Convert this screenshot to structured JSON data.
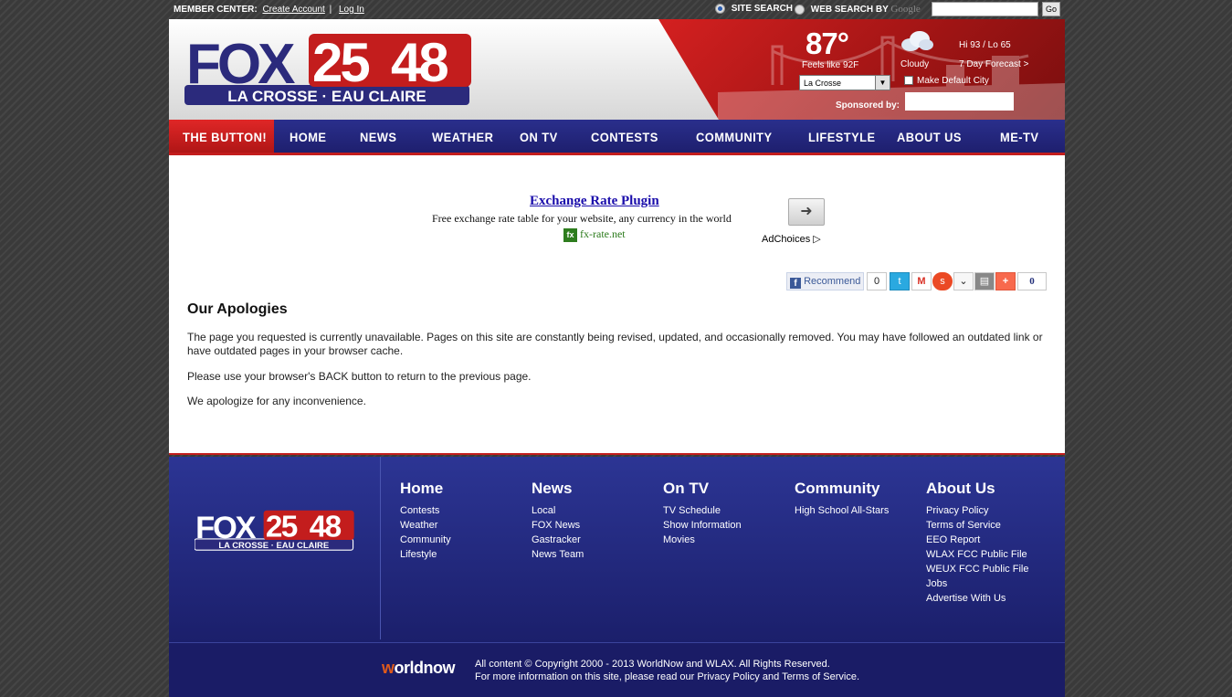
{
  "topbar": {
    "member_center": "MEMBER CENTER:",
    "create_account": "Create Account",
    "separator": "|",
    "log_in": "Log In",
    "site_search": "SITE SEARCH",
    "web_search": "WEB SEARCH BY",
    "google": "Google",
    "search_value": "",
    "go": "Go"
  },
  "logo": {
    "fox": "FOX",
    "num1": "25",
    "num2": "48",
    "tagline": "LA CROSSE · EAU CLAIRE"
  },
  "weather": {
    "temp": "87°",
    "feels_like": "Feels like 92F",
    "condition": "Cloudy",
    "hilo": "Hi 93 / Lo 65",
    "forecast_link": "7 Day Forecast >",
    "city": "La Crosse",
    "make_default": "Make Default City",
    "sponsored_by": "Sponsored by:"
  },
  "nav": {
    "the_button": "THE BUTTON!",
    "items": [
      "HOME",
      "NEWS",
      "WEATHER",
      "ON TV",
      "CONTESTS",
      "COMMUNITY",
      "LIFESTYLE",
      "ABOUT US",
      "ME-TV"
    ]
  },
  "ad": {
    "title": "Exchange Rate Plugin",
    "text": "Free exchange rate table for your website, any currency in the world",
    "fx": "fx",
    "site": "fx-rate.net",
    "adchoices": "AdChoices"
  },
  "share": {
    "recommend": "Recommend",
    "fb_count": "0",
    "total_count": "0"
  },
  "page": {
    "heading": "Our Apologies",
    "p1": "The page you requested is currently unavailable. Pages on this site are constantly being revised, updated, and occasionally removed. You may have followed an outdated link or have outdated pages in your browser cache.",
    "p2": "Please use your browser's BACK button to return to the previous page.",
    "p3": "We apologize for any inconvenience."
  },
  "footer": {
    "columns": [
      {
        "title": "Home",
        "links": [
          "Contests",
          "Weather",
          "Community",
          "Lifestyle"
        ]
      },
      {
        "title": "News",
        "links": [
          "Local",
          "FOX News",
          "Gastracker",
          "News Team"
        ]
      },
      {
        "title": "On TV",
        "links": [
          "TV Schedule",
          "Show Information",
          "Movies"
        ]
      },
      {
        "title": "Community",
        "links": [
          "High School All-Stars"
        ]
      },
      {
        "title": "About Us",
        "links": [
          "Privacy Policy",
          "Terms of Service",
          "EEO Report",
          "WLAX FCC Public File",
          "WEUX FCC Public File",
          "Jobs",
          "Advertise With Us"
        ]
      }
    ],
    "worldnow_w": "w",
    "worldnow_rest": "orldnow",
    "copyright1": "All content © Copyright 2000 - 2013 WorldNow and WLAX. All Rights Reserved.",
    "copyright2": "For more information on this site, please read our Privacy Policy and Terms of Service."
  },
  "colors": {
    "brand_red": "#c31d1d",
    "brand_blue": "#1e1f6e",
    "fox_blue": "#2b2a7c"
  }
}
